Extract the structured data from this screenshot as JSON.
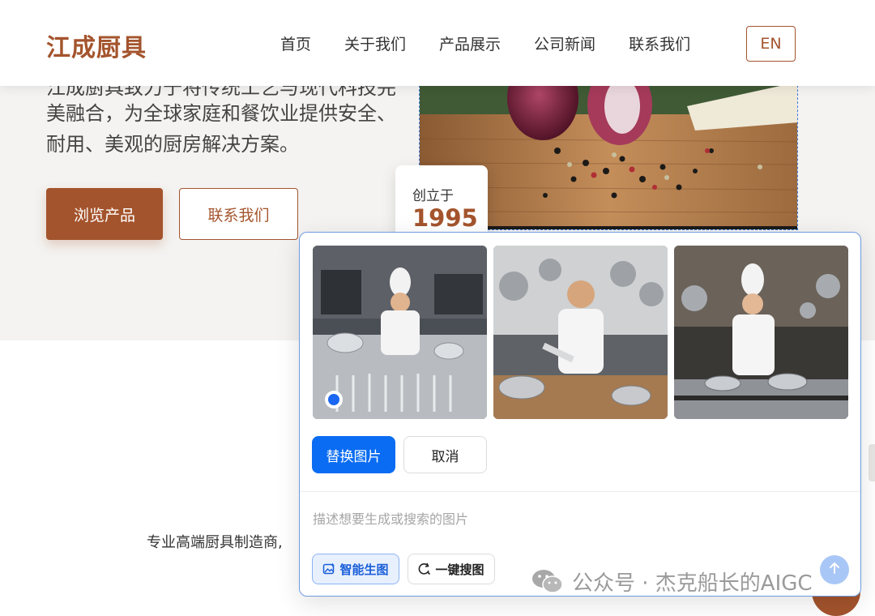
{
  "header": {
    "logo": "江成厨具",
    "nav": [
      "首页",
      "关于我们",
      "产品展示",
      "公司新闻",
      "联系我们"
    ],
    "lang": "EN"
  },
  "hero": {
    "line_partial": "江成厨具致力于将传统工艺与现代科技完",
    "line2": "美融合，为全球家庭和餐饮业提供安全、",
    "line3": "耐用、美观的厨房解决方案。",
    "btn_browse": "浏览产品",
    "btn_contact": "联系我们",
    "founded_label": "创立于",
    "founded_year": "1995"
  },
  "tagline": "专业高端厨具制造商,",
  "panel": {
    "thumbs": [
      "chef-prep-photo",
      "chef-knife-photo",
      "chef-stove-photo"
    ],
    "selected_index": 0,
    "replace_label": "替换图片",
    "cancel_label": "取消",
    "prompt_placeholder": "描述想要生成或搜索的图片",
    "chip_ai": "智能生图",
    "chip_search": "一键搜图"
  },
  "watermark": "公众号 · 杰克船长的AIGC",
  "colors": {
    "brand": "#a4542d",
    "accent": "#0a6cf2"
  }
}
